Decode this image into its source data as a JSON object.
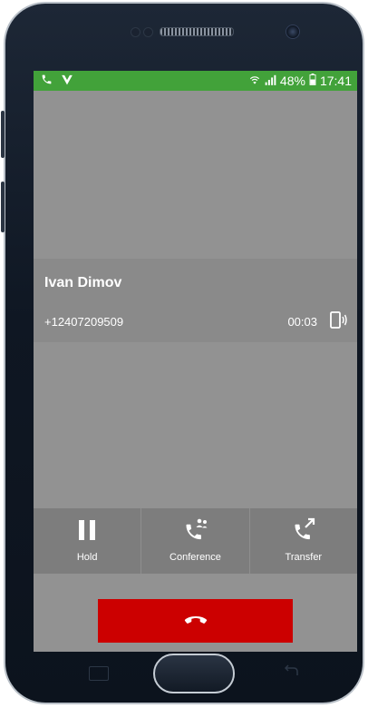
{
  "status_bar": {
    "battery": "48%",
    "time": "17:41",
    "left_icons": [
      "phone-icon",
      "vibe-icon"
    ],
    "right_icons": [
      "wifi-icon",
      "signal-icon",
      "battery-icon"
    ]
  },
  "call": {
    "contact_name": "Ivan Dimov",
    "phone_number": "+12407209509",
    "duration": "00:03"
  },
  "actions": [
    {
      "label": "Hold",
      "icon": "pause-icon"
    },
    {
      "label": "Conference",
      "icon": "conference-icon"
    },
    {
      "label": "Transfer",
      "icon": "transfer-icon"
    }
  ],
  "end_call": {
    "icon": "end-call-icon",
    "color": "#cc0000"
  },
  "colors": {
    "status_bar": "#42a23a",
    "screen_bg": "#929292",
    "contact_panel": "#8a8a8a",
    "action_bar": "#7d7d7d"
  }
}
